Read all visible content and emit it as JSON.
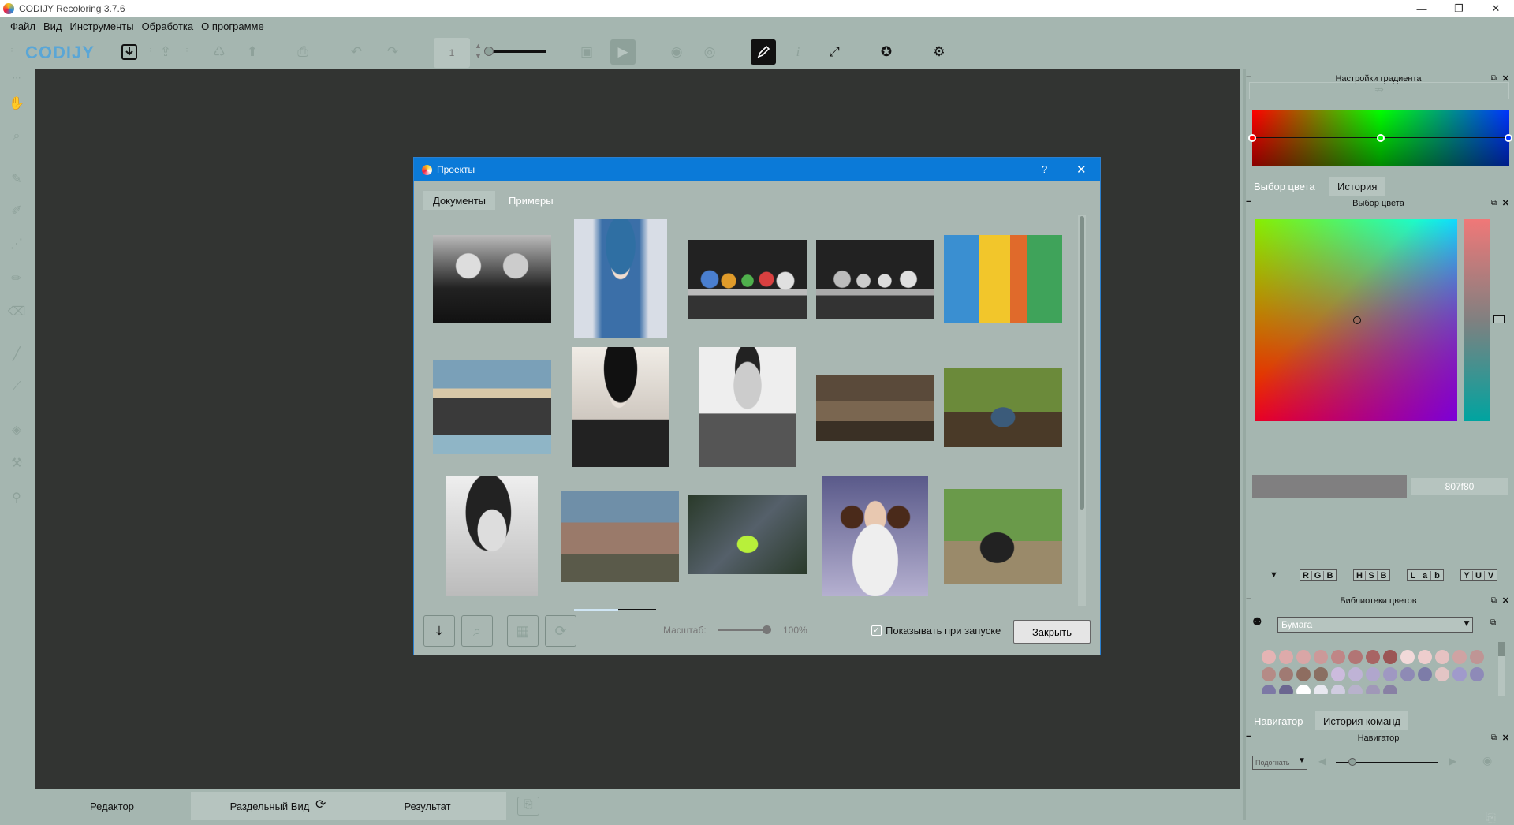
{
  "app": {
    "title": "CODIJY Recoloring 3.7.6",
    "brand": "CODIJY"
  },
  "window_buttons": {
    "minimize": "—",
    "restore": "❐",
    "close": "✕"
  },
  "menu": [
    "Файл",
    "Вид",
    "Инструменты",
    "Обработка",
    "О программе"
  ],
  "toolbar": {
    "page_number": "1",
    "icons": [
      "brand-logo",
      "import-icon",
      "export-icon",
      "share-icon",
      "upload-icon",
      "print-icon",
      "undo-icon",
      "redo-icon",
      "page-input",
      "brush-size-slider",
      "record-icon",
      "play-icon",
      "eye-icon",
      "eye-half-icon",
      "pencil-icon",
      "info-icon",
      "fullscreen-icon",
      "star-icon",
      "settings-icon"
    ]
  },
  "bottom_tabs": {
    "editor": "Редактор",
    "split": "Раздельный Вид",
    "result": "Результат"
  },
  "right_panel": {
    "gradient_title": "Настройки градиента",
    "tabs1": [
      "Выбор цвета",
      "История"
    ],
    "picker_title": "Выбор цвета",
    "hex_value": "807f80",
    "format_groups": [
      [
        "R",
        "G",
        "B"
      ],
      [
        "H",
        "S",
        "B"
      ],
      [
        "L",
        "a",
        "b"
      ],
      [
        "Y",
        "U",
        "V"
      ]
    ],
    "libraries_title": "Библиотеки цветов",
    "library_select": "Бумага",
    "tabs2": [
      "Навигатор",
      "История команд"
    ],
    "navigator_title": "Навигатор",
    "fit_select": "Подогнать",
    "swatches": [
      "#e5b4b4",
      "#ddaaaa",
      "#d9a6a6",
      "#cc9999",
      "#c08686",
      "#b27575",
      "#a86464",
      "#9b5555",
      "#f2d9d9",
      "#eecdcd",
      "#e6c2c2",
      "#cfa3a3",
      "#bf9595",
      "#b58b86",
      "#a07a73",
      "#8e6d60",
      "#8a6f62",
      "#ccbbdd",
      "#bfb3d6",
      "#b0a6cd",
      "#9f98c2",
      "#8e8ab5",
      "#7d7ca8",
      "#e3c5c5",
      "#a09acb",
      "#8e8ab8",
      "#7c78a5",
      "#6b6690",
      "#ffffff",
      "#e8e8f0",
      "#d0cce0",
      "#b8b2cc",
      "#a098b8",
      "#8880a4"
    ]
  },
  "dialog": {
    "title": "Проекты",
    "help": "?",
    "close_x": "✕",
    "tabs": [
      "Документы",
      "Примеры"
    ],
    "scale_label": "Масштаб:",
    "scale_value": "100%",
    "show_on_start": "Показывать при запуске",
    "close_button": "Закрыть",
    "thumbnails": [
      "couple-bw",
      "girl-blue-hat",
      "birds-color",
      "birds-bw",
      "colorful-houses",
      "group-pool",
      "dancer-bw",
      "man-uniform-bw",
      "living-room",
      "fruit-bowl",
      "woman-portrait-bw",
      "family-photo",
      "green-jacket-road",
      "princess-leia",
      "vintage-car"
    ]
  }
}
